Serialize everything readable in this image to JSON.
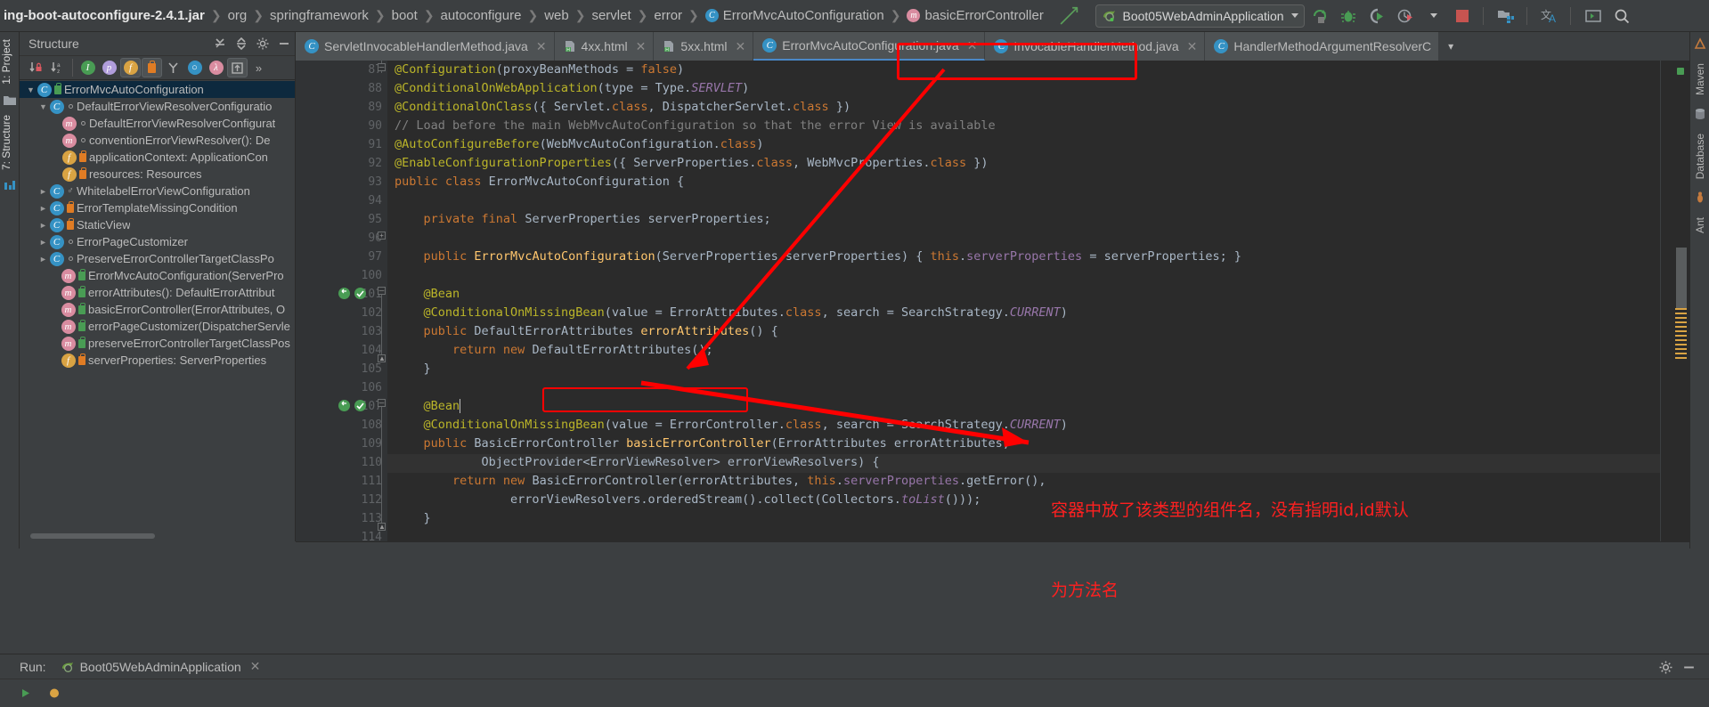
{
  "navbar": {
    "breadcrumbs": [
      {
        "label": "ing-boot-autoconfigure-2.4.1.jar",
        "icon": "jar-icon",
        "kind": "jar"
      },
      {
        "label": "org",
        "icon": "package-icon",
        "kind": "pkg"
      },
      {
        "label": "springframework",
        "icon": "package-icon",
        "kind": "pkg"
      },
      {
        "label": "boot",
        "icon": "package-icon",
        "kind": "pkg"
      },
      {
        "label": "autoconfigure",
        "icon": "package-icon",
        "kind": "pkg"
      },
      {
        "label": "web",
        "icon": "package-icon",
        "kind": "pkg"
      },
      {
        "label": "servlet",
        "icon": "package-icon",
        "kind": "pkg"
      },
      {
        "label": "error",
        "icon": "package-icon",
        "kind": "pkg"
      },
      {
        "label": "ErrorMvcAutoConfiguration",
        "icon": "class-icon",
        "kind": "class"
      },
      {
        "label": "basicErrorController",
        "icon": "method-icon",
        "kind": "method"
      }
    ],
    "run_configuration": "Boot05WebAdminApplication",
    "toolbar_icons": [
      "run-icon",
      "debug-icon",
      "run-with-coverage-icon",
      "profiler-icon",
      "chevron-down-icon",
      "stop-icon",
      "project-structure-icon",
      "translate-icon",
      "terminal-icon",
      "search-everywhere-icon"
    ]
  },
  "left_strip": {
    "items": [
      {
        "label": "1: Project",
        "name": "tool-window-project"
      },
      {
        "label": "7: Structure",
        "name": "tool-window-structure"
      }
    ]
  },
  "right_strip": {
    "items": [
      {
        "label": "Maven",
        "name": "tool-window-maven"
      },
      {
        "label": "Database",
        "name": "tool-window-database"
      },
      {
        "label": "Ant",
        "name": "tool-window-ant"
      }
    ]
  },
  "structure": {
    "title": "Structure",
    "header_icons": [
      "expand-all-icon",
      "collapse-all-icon",
      "settings-icon",
      "hide-icon"
    ],
    "toolbar_icons": [
      {
        "name": "sort-by-visibility-icon",
        "active": false
      },
      {
        "name": "sort-alphabetically-icon",
        "active": false
      },
      {
        "name": "show-inherited-icon",
        "active": false
      },
      {
        "name": "show-properties-icon",
        "active": false
      },
      {
        "name": "show-fields-icon",
        "active": true
      },
      {
        "name": "show-non-public-icon",
        "active": true
      },
      {
        "name": "group-by-icon",
        "active": false
      },
      {
        "name": "show-anonymous-icon",
        "active": false
      },
      {
        "name": "show-lambdas-icon",
        "active": false
      },
      {
        "name": "autoscroll-to-source-icon",
        "active": true
      },
      {
        "name": "more-icon",
        "active": false
      }
    ],
    "tree": [
      {
        "indent": 0,
        "twisty": "down",
        "icon": "class-icon",
        "modifier": "lock-green",
        "label": "ErrorMvcAutoConfiguration",
        "selected": true
      },
      {
        "indent": 1,
        "twisty": "down",
        "icon": "class-icon",
        "modifier": "dot",
        "label": "DefaultErrorViewResolverConfiguratio",
        "selected": false
      },
      {
        "indent": 2,
        "twisty": "none",
        "icon": "method-icon",
        "modifier": "dot",
        "label": "DefaultErrorViewResolverConfigurat",
        "selected": false
      },
      {
        "indent": 2,
        "twisty": "none",
        "icon": "method-icon",
        "modifier": "dot",
        "label": "conventionErrorViewResolver(): De",
        "selected": false
      },
      {
        "indent": 2,
        "twisty": "none",
        "icon": "field-icon",
        "modifier": "lock-orange",
        "label": "applicationContext: ApplicationCon",
        "selected": false
      },
      {
        "indent": 2,
        "twisty": "none",
        "icon": "field-icon",
        "modifier": "lock-orange",
        "label": "resources: Resources",
        "selected": false
      },
      {
        "indent": 1,
        "twisty": "right",
        "icon": "class-icon",
        "modifier": "key",
        "label": "WhitelabelErrorViewConfiguration",
        "selected": false
      },
      {
        "indent": 1,
        "twisty": "right",
        "icon": "class-icon",
        "modifier": "lock-orange",
        "label": "ErrorTemplateMissingCondition",
        "selected": false
      },
      {
        "indent": 1,
        "twisty": "right",
        "icon": "class-icon",
        "modifier": "lock-orange",
        "label": "StaticView",
        "selected": false
      },
      {
        "indent": 1,
        "twisty": "right",
        "icon": "class-icon",
        "modifier": "dot",
        "label": "ErrorPageCustomizer",
        "selected": false
      },
      {
        "indent": 1,
        "twisty": "right",
        "icon": "class-icon",
        "modifier": "dot",
        "label": "PreserveErrorControllerTargetClassPo",
        "selected": false
      },
      {
        "indent": 1,
        "twisty": "none",
        "icon": "method-icon",
        "modifier": "lock-green",
        "label": "ErrorMvcAutoConfiguration(ServerPro",
        "selected": false
      },
      {
        "indent": 1,
        "twisty": "none",
        "icon": "method-icon",
        "modifier": "lock-green",
        "label": "errorAttributes(): DefaultErrorAttribut",
        "selected": false
      },
      {
        "indent": 1,
        "twisty": "none",
        "icon": "method-icon",
        "modifier": "lock-green",
        "label": "basicErrorController(ErrorAttributes, O",
        "selected": false
      },
      {
        "indent": 1,
        "twisty": "none",
        "icon": "method-icon",
        "modifier": "lock-green",
        "label": "errorPageCustomizer(DispatcherServle",
        "selected": false
      },
      {
        "indent": 1,
        "twisty": "none",
        "icon": "method-icon",
        "modifier": "lock-green",
        "label": "preserveErrorControllerTargetClassPos",
        "selected": false
      },
      {
        "indent": 1,
        "twisty": "none",
        "icon": "field-icon",
        "modifier": "lock-orange",
        "label": "serverProperties: ServerProperties",
        "selected": false
      }
    ]
  },
  "editor_tabs": [
    {
      "label": "ServletInvocableHandlerMethod.java",
      "icon": "class-file-icon",
      "active": false,
      "closable": true
    },
    {
      "label": "4xx.html",
      "icon": "html-file-icon",
      "active": false,
      "closable": true
    },
    {
      "label": "5xx.html",
      "icon": "html-file-icon",
      "active": false,
      "closable": true
    },
    {
      "label": "ErrorMvcAutoConfiguration.java",
      "icon": "class-file-icon",
      "active": true,
      "closable": true
    },
    {
      "label": "InvocableHandlerMethod.java",
      "icon": "class-file-icon",
      "active": false,
      "closable": true
    },
    {
      "label": "HandlerMethodArgumentResolverC",
      "icon": "class-file-icon",
      "active": false,
      "closable": false
    }
  ],
  "code": {
    "first_line": 87,
    "lines": [
      {
        "num": 87,
        "partial": true,
        "tokens": [
          {
            "t": "@Configuration",
            "c": "ann"
          },
          {
            "t": "(",
            "c": "pln"
          },
          {
            "t": "proxyBeanMethods",
            "c": "pln"
          },
          {
            "t": " = ",
            "c": "pln"
          },
          {
            "t": "false",
            "c": "kw"
          },
          {
            "t": ")",
            "c": "pln"
          }
        ]
      },
      {
        "num": 88,
        "tokens": [
          {
            "t": "@ConditionalOnWebApplication",
            "c": "ann"
          },
          {
            "t": "(",
            "c": "pln"
          },
          {
            "t": "type",
            "c": "pln"
          },
          {
            "t": " = ",
            "c": "pln"
          },
          {
            "t": "Type.",
            "c": "pln"
          },
          {
            "t": "SERVLET",
            "c": "ital"
          },
          {
            "t": ")",
            "c": "pln"
          }
        ]
      },
      {
        "num": 89,
        "tokens": [
          {
            "t": "@ConditionalOnClass",
            "c": "ann"
          },
          {
            "t": "({ Servlet.",
            "c": "pln"
          },
          {
            "t": "class",
            "c": "kw"
          },
          {
            "t": ", DispatcherServlet.",
            "c": "pln"
          },
          {
            "t": "class",
            "c": "kw"
          },
          {
            "t": " })",
            "c": "pln"
          }
        ]
      },
      {
        "num": 90,
        "tokens": [
          {
            "t": "// Load before the main WebMvcAutoConfiguration so that the error View is available",
            "c": "cmt"
          }
        ]
      },
      {
        "num": 91,
        "tokens": [
          {
            "t": "@AutoConfigureBefore",
            "c": "ann"
          },
          {
            "t": "(WebMvcAutoConfiguration.",
            "c": "pln"
          },
          {
            "t": "class",
            "c": "kw"
          },
          {
            "t": ")",
            "c": "pln"
          }
        ]
      },
      {
        "num": 92,
        "tokens": [
          {
            "t": "@EnableConfigurationProperties",
            "c": "ann"
          },
          {
            "t": "({ ServerProperties.",
            "c": "pln"
          },
          {
            "t": "class",
            "c": "kw"
          },
          {
            "t": ", WebMvcProperties.",
            "c": "pln"
          },
          {
            "t": "class",
            "c": "kw"
          },
          {
            "t": " })",
            "c": "pln"
          }
        ]
      },
      {
        "num": 93,
        "tokens": [
          {
            "t": "public class ",
            "c": "kw"
          },
          {
            "t": "ErrorMvcAutoConfiguration {",
            "c": "pln"
          }
        ]
      },
      {
        "num": 94,
        "tokens": []
      },
      {
        "num": 95,
        "indent": 1,
        "tokens": [
          {
            "t": "private final ",
            "c": "kw"
          },
          {
            "t": "ServerProperties serverProperties;",
            "c": "pln"
          }
        ]
      },
      {
        "num": 96,
        "tokens": []
      },
      {
        "num": 97,
        "indent": 1,
        "tokens": [
          {
            "t": "public ",
            "c": "kw"
          },
          {
            "t": "ErrorMvcAutoConfiguration",
            "c": "mtd"
          },
          {
            "t": "(ServerProperties serverProperties) { ",
            "c": "pln"
          },
          {
            "t": "this",
            "c": "kw"
          },
          {
            "t": ".",
            "c": "pln"
          },
          {
            "t": "serverProperties",
            "c": "fld"
          },
          {
            "t": " = serverProperties; }",
            "c": "pln"
          }
        ]
      },
      {
        "num": 100,
        "tokens": []
      },
      {
        "num": 101,
        "indent": 1,
        "gutter_icons": [
          "bean-icon",
          "spring-icon"
        ],
        "tokens": [
          {
            "t": "@Bean",
            "c": "ann"
          }
        ]
      },
      {
        "num": 102,
        "indent": 1,
        "tokens": [
          {
            "t": "@ConditionalOnMissingBean",
            "c": "ann"
          },
          {
            "t": "(",
            "c": "pln"
          },
          {
            "t": "value",
            "c": "pln"
          },
          {
            "t": " = ErrorAttributes.",
            "c": "pln"
          },
          {
            "t": "class",
            "c": "kw"
          },
          {
            "t": ", ",
            "c": "pln"
          },
          {
            "t": "search",
            "c": "pln"
          },
          {
            "t": " = SearchStrategy.",
            "c": "pln"
          },
          {
            "t": "CURRENT",
            "c": "ital"
          },
          {
            "t": ")",
            "c": "pln"
          }
        ]
      },
      {
        "num": 103,
        "indent": 1,
        "tokens": [
          {
            "t": "public ",
            "c": "kw"
          },
          {
            "t": "DefaultErrorAttributes ",
            "c": "pln"
          },
          {
            "t": "errorAttributes",
            "c": "mtd"
          },
          {
            "t": "() {",
            "c": "pln"
          }
        ]
      },
      {
        "num": 104,
        "indent": 2,
        "tokens": [
          {
            "t": "return new ",
            "c": "kw"
          },
          {
            "t": "DefaultErrorAttributes();",
            "c": "pln"
          }
        ]
      },
      {
        "num": 105,
        "indent": 1,
        "tokens": [
          {
            "t": "}",
            "c": "pln"
          }
        ]
      },
      {
        "num": 106,
        "tokens": []
      },
      {
        "num": 107,
        "indent": 1,
        "gutter_icons": [
          "bean-icon",
          "spring-icon"
        ],
        "tokens": [
          {
            "t": "@Bean",
            "c": "ann"
          }
        ],
        "caret": true
      },
      {
        "num": 108,
        "indent": 1,
        "tokens": [
          {
            "t": "@ConditionalOnMissingBean",
            "c": "ann"
          },
          {
            "t": "(",
            "c": "pln"
          },
          {
            "t": "value",
            "c": "pln"
          },
          {
            "t": " = ErrorController.",
            "c": "pln"
          },
          {
            "t": "class",
            "c": "kw"
          },
          {
            "t": ", ",
            "c": "pln"
          },
          {
            "t": "search",
            "c": "pln"
          },
          {
            "t": " = SearchStrategy.",
            "c": "pln"
          },
          {
            "t": "CURRENT",
            "c": "ital"
          },
          {
            "t": ")",
            "c": "pln"
          }
        ]
      },
      {
        "num": 109,
        "indent": 1,
        "tokens": [
          {
            "t": "public ",
            "c": "kw"
          },
          {
            "t": "BasicErrorController ",
            "c": "pln"
          },
          {
            "t": "basicErrorController",
            "c": "mtd"
          },
          {
            "t": "(ErrorAttributes errorAttributes,",
            "c": "pln"
          }
        ]
      },
      {
        "num": 110,
        "indent": 3,
        "tokens": [
          {
            "t": "ObjectProvider<ErrorViewResolver> errorViewResolvers) {",
            "c": "pln"
          }
        ]
      },
      {
        "num": 111,
        "indent": 2,
        "tokens": [
          {
            "t": "return new ",
            "c": "kw"
          },
          {
            "t": "BasicErrorController(errorAttributes, ",
            "c": "pln"
          },
          {
            "t": "this",
            "c": "kw"
          },
          {
            "t": ".",
            "c": "pln"
          },
          {
            "t": "serverProperties",
            "c": "fld"
          },
          {
            "t": ".getError(),",
            "c": "pln"
          }
        ]
      },
      {
        "num": 112,
        "indent": 3,
        "tokens": [
          {
            "t": "errorViewResolvers.orderedStream().collect(Collectors.",
            "c": "pln"
          },
          {
            "t": "toList",
            "c": "ital"
          },
          {
            "t": "()));",
            "c": "pln"
          }
        ]
      },
      {
        "num": 113,
        "indent": 1,
        "tokens": [
          {
            "t": "}",
            "c": "pln"
          }
        ]
      },
      {
        "num": 114,
        "tokens": []
      }
    ]
  },
  "annotations": {
    "note_line1": "容器中放了该类型的组件名，没有指明id,id默认",
    "note_line2": "为方法名",
    "color": "#ff2020",
    "boxes": [
      {
        "name": "tab-highlight-box",
        "target": "ErrorMvcAutoConfiguration.java tab"
      },
      {
        "name": "return-type-box",
        "target": "DefaultErrorAttributes return type"
      }
    ]
  },
  "bottom": {
    "run_label": "Run:",
    "run_tab": "Boot05WebAdminApplication",
    "icons": [
      "settings-icon",
      "hide-icon"
    ]
  }
}
